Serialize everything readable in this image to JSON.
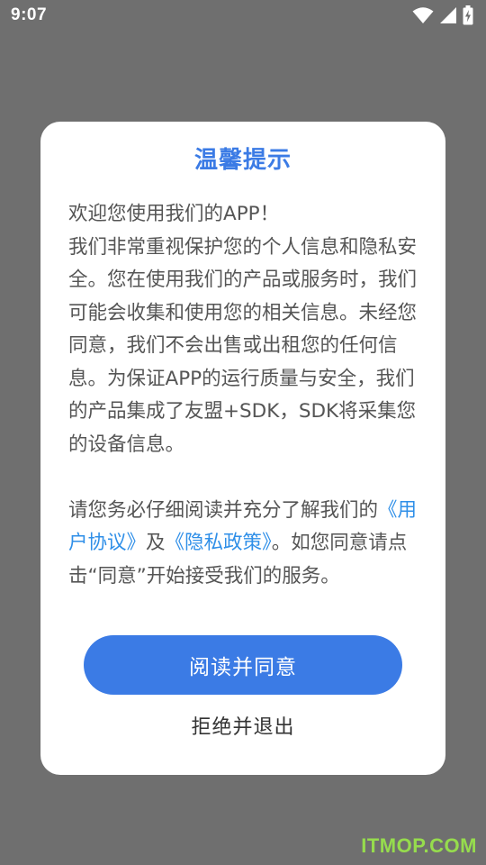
{
  "status_bar": {
    "time": "9:07",
    "icons": [
      "wifi-icon",
      "signal-icon",
      "battery-charging-icon"
    ]
  },
  "dialog": {
    "title": "温馨提示",
    "intro": "欢迎您使用我们的APP！",
    "para1": "我们非常重视保护您的个人信息和隐私安全。您在使用我们的产品或服务时，我们可能会收集和使用您的相关信息。未经您同意，我们不会出售或出租您的任何信息。为保证APP的运行质量与安全，我们的产品集成了友盟+SDK，SDK将采集您的设备信息。",
    "para2_prefix": "请您务必仔细阅读并充分了解我们的",
    "user_agreement_link": "《用户协议》",
    "and_text": "及",
    "privacy_policy_link": "《隐私政策》",
    "para2_suffix": "。如您同意请点击“同意”开始接受我们的服务。",
    "agree_label": "阅读并同意",
    "reject_label": "拒绝并退出"
  },
  "watermark": "ITMOP.COM",
  "colors": {
    "accent": "#3b7be5",
    "link": "#2f8fe8",
    "overlay": "#6f6f6f"
  }
}
